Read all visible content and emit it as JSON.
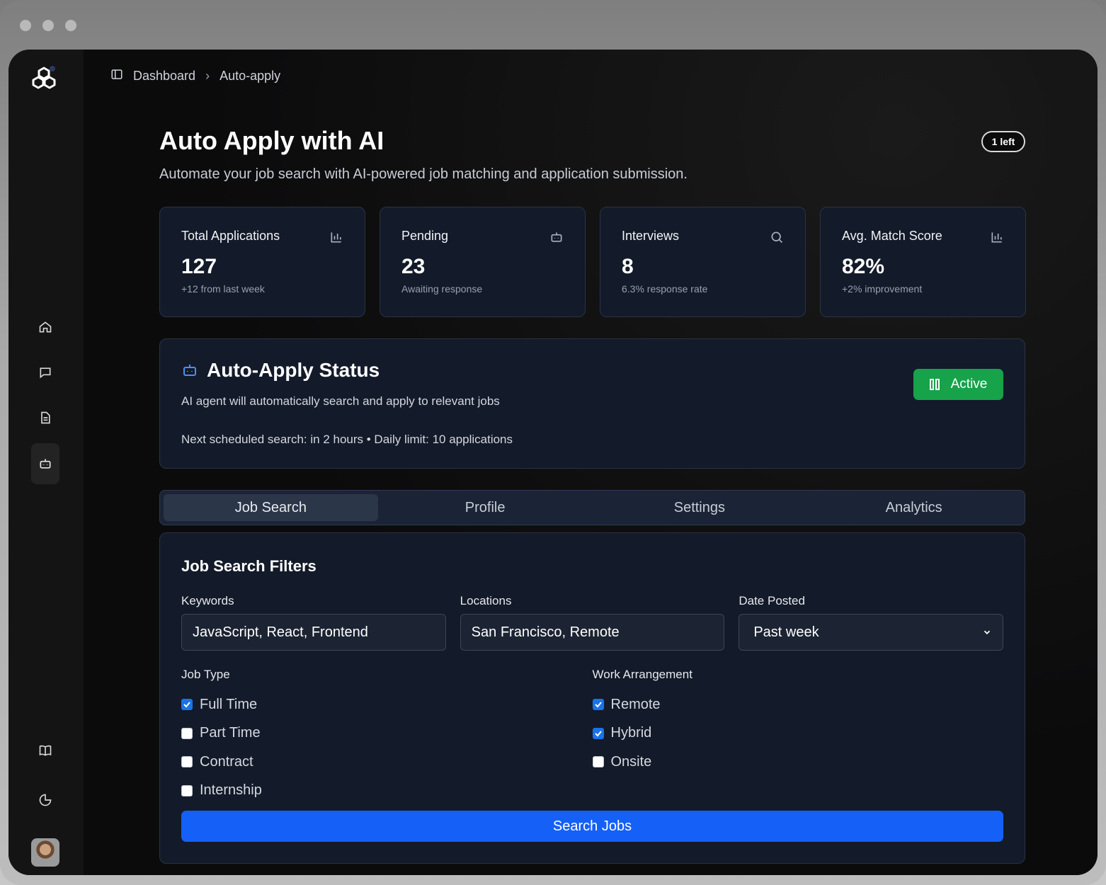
{
  "breadcrumb": {
    "root": "Dashboard",
    "current": "Auto-apply"
  },
  "header": {
    "title": "Auto Apply with AI",
    "subtitle": "Automate your job search with AI-powered job matching and application submission.",
    "badge": "1 left"
  },
  "stats": [
    {
      "label": "Total Applications",
      "value": "127",
      "sub": "+12 from last week",
      "icon": "bar-chart-icon"
    },
    {
      "label": "Pending",
      "value": "23",
      "sub": "Awaiting response",
      "icon": "bot-icon"
    },
    {
      "label": "Interviews",
      "value": "8",
      "sub": "6.3% response rate",
      "icon": "search-icon"
    },
    {
      "label": "Avg. Match Score",
      "value": "82%",
      "sub": "+2% improvement",
      "icon": "bar-chart-icon"
    }
  ],
  "status": {
    "title": "Auto-Apply Status",
    "description": "AI agent will automatically search and apply to relevant jobs",
    "next": "Next scheduled search: in 2 hours • Daily limit: 10 applications",
    "button": "Active"
  },
  "tabs": [
    "Job Search",
    "Profile",
    "Settings",
    "Analytics"
  ],
  "filters": {
    "title": "Job Search Filters",
    "keywords_label": "Keywords",
    "keywords_value": "JavaScript, React, Frontend",
    "locations_label": "Locations",
    "locations_value": "San Francisco, Remote",
    "date_label": "Date Posted",
    "date_value": "Past week",
    "job_type_label": "Job Type",
    "job_types": [
      {
        "label": "Full Time",
        "checked": true
      },
      {
        "label": "Part Time",
        "checked": false
      },
      {
        "label": "Contract",
        "checked": false
      },
      {
        "label": "Internship",
        "checked": false
      }
    ],
    "work_label": "Work Arrangement",
    "work": [
      {
        "label": "Remote",
        "checked": true
      },
      {
        "label": "Hybrid",
        "checked": true
      },
      {
        "label": "Onsite",
        "checked": false
      }
    ],
    "search_button": "Search Jobs"
  },
  "colors": {
    "accent": "#1560f7",
    "success": "#16a34a",
    "card": "#131a29"
  }
}
